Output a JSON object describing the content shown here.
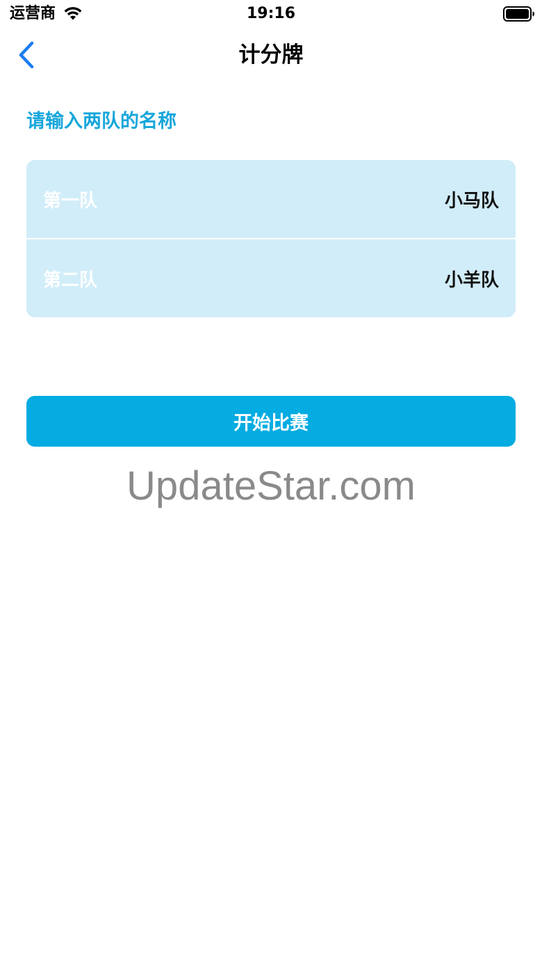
{
  "status_bar": {
    "carrier": "运营商",
    "time": "19:16",
    "wifi_icon": "wifi-icon",
    "battery_icon": "battery-full-icon"
  },
  "nav": {
    "title": "计分牌",
    "back_icon": "chevron-left-icon",
    "accent_color": "#1a7cf0"
  },
  "form": {
    "section_title": "请输入两队的名称",
    "rows": [
      {
        "label": "第一队",
        "value": "小马队"
      },
      {
        "label": "第二队",
        "value": "小羊队"
      }
    ],
    "card_color": "#d1edf9"
  },
  "actions": {
    "start_label": "开始比赛",
    "button_color": "#04ace1"
  },
  "watermark": {
    "text": "UpdateStar.com"
  }
}
